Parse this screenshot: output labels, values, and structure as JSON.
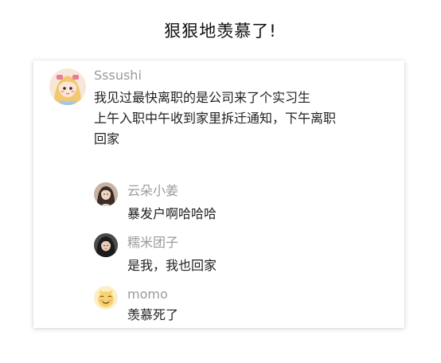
{
  "headline": "狠狠地羡慕了!",
  "post": {
    "author": "Sssushi",
    "avatar_icon": "anime-girl-avatar-icon",
    "lines": [
      "我见过最快离职的是公司来了个实习生",
      "上午入职中午收到家里拆迁通知，下午离职",
      "回家"
    ]
  },
  "replies": [
    {
      "author": "云朵小姜",
      "text": "暴发户啊哈哈哈",
      "avatar_icon": "portrait-avatar-icon"
    },
    {
      "author": "糯米团子",
      "text": "是我，我也回家",
      "avatar_icon": "portrait-avatar-icon"
    },
    {
      "author": "momo",
      "text": "羡慕死了",
      "avatar_icon": "cartoon-face-avatar-icon"
    }
  ],
  "colors": {
    "username": "#9a9a9a",
    "body_text": "#1f1f1f",
    "card_background": "#ffffff"
  }
}
